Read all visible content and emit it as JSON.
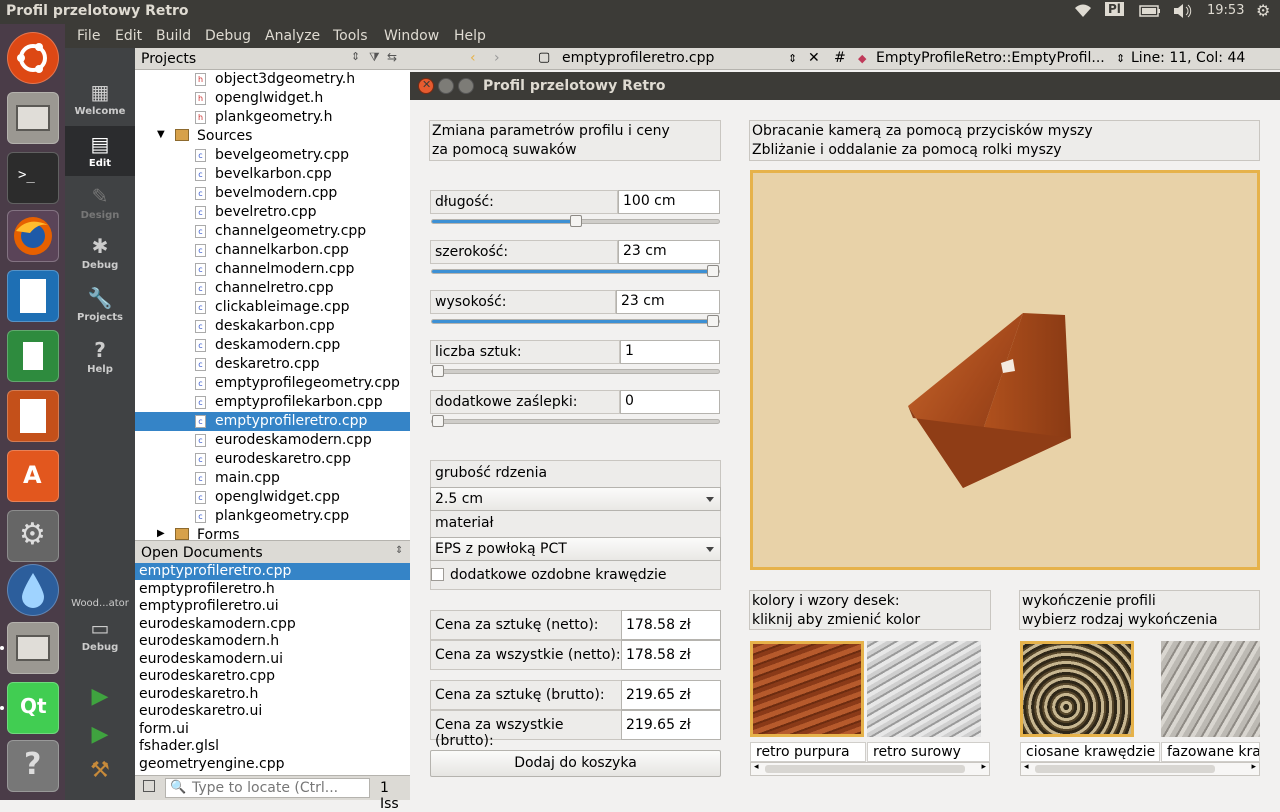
{
  "topbar": {
    "title": "Profil przelotowy Retro",
    "keyboard": "Pl",
    "time": "19:53"
  },
  "launcher": {
    "icons": [
      "ubuntu-icon",
      "files-icon",
      "terminal-icon",
      "firefox-icon",
      "writer-icon",
      "calc-icon",
      "impress-icon",
      "software-center-icon",
      "settings-icon",
      "drop-icon",
      "files-icon",
      "qt-creator-icon",
      "help-icon"
    ]
  },
  "menubar": {
    "items": [
      "File",
      "Edit",
      "Build",
      "Debug",
      "Analyze",
      "Tools",
      "Window",
      "Help"
    ]
  },
  "modes": {
    "welcome": "Welcome",
    "edit": "Edit",
    "design": "Design",
    "debug": "Debug",
    "projects": "Projects",
    "help": "Help",
    "kit_name": "Wood...ator",
    "kit_mode": "Debug"
  },
  "projects": {
    "header": "Projects",
    "rows": [
      {
        "name": "object3dgeometry.h",
        "type": "h"
      },
      {
        "name": "openglwidget.h",
        "type": "h"
      },
      {
        "name": "plankgeometry.h",
        "type": "h"
      },
      {
        "name": "Sources",
        "type": "folder"
      },
      {
        "name": "bevelgeometry.cpp",
        "type": "cpp"
      },
      {
        "name": "bevelkarbon.cpp",
        "type": "cpp"
      },
      {
        "name": "bevelmodern.cpp",
        "type": "cpp"
      },
      {
        "name": "bevelretro.cpp",
        "type": "cpp"
      },
      {
        "name": "channelgeometry.cpp",
        "type": "cpp"
      },
      {
        "name": "channelkarbon.cpp",
        "type": "cpp"
      },
      {
        "name": "channelmodern.cpp",
        "type": "cpp"
      },
      {
        "name": "channelretro.cpp",
        "type": "cpp"
      },
      {
        "name": "clickableimage.cpp",
        "type": "cpp"
      },
      {
        "name": "deskakarbon.cpp",
        "type": "cpp"
      },
      {
        "name": "deskamodern.cpp",
        "type": "cpp"
      },
      {
        "name": "deskaretro.cpp",
        "type": "cpp"
      },
      {
        "name": "emptyprofilegeometry.cpp",
        "type": "cpp"
      },
      {
        "name": "emptyprofilekarbon.cpp",
        "type": "cpp"
      },
      {
        "name": "emptyprofileretro.cpp",
        "type": "cpp",
        "selected": true
      },
      {
        "name": "eurodeskamodern.cpp",
        "type": "cpp"
      },
      {
        "name": "eurodeskaretro.cpp",
        "type": "cpp"
      },
      {
        "name": "main.cpp",
        "type": "cpp"
      },
      {
        "name": "openglwidget.cpp",
        "type": "cpp"
      },
      {
        "name": "plankgeometry.cpp",
        "type": "cpp"
      },
      {
        "name": "Forms",
        "type": "folder"
      }
    ]
  },
  "open_documents": {
    "header": "Open Documents",
    "items": [
      "emptyprofileretro.cpp",
      "emptyprofileretro.h",
      "emptyprofileretro.ui",
      "eurodeskamodern.cpp",
      "eurodeskamodern.h",
      "eurodeskamodern.ui",
      "eurodeskaretro.cpp",
      "eurodeskaretro.h",
      "eurodeskaretro.ui",
      "form.ui",
      "fshader.glsl",
      "geometryengine.cpp"
    ]
  },
  "locator": {
    "placeholder": "Type to locate (Ctrl...",
    "issues": "1  Iss"
  },
  "editor": {
    "file": "emptyprofileretro.cpp",
    "symbol": "EmptyProfileRetro::EmptyProfil...",
    "position": "Line: 11, Col: 44"
  },
  "app": {
    "title": "Profil przelotowy Retro",
    "intro_line1": "Zmiana parametrów profilu i ceny",
    "intro_line2": "za pomocą suwaków",
    "camera_line1": "Obracanie kamerą za pomocą przycisków myszy",
    "camera_line2": "Zbliżanie i oddalanie za pomocą rolki myszy",
    "params": [
      {
        "label": "długość:",
        "value": "100 cm",
        "level": 0.5
      },
      {
        "label": "szerokość:",
        "value": "23 cm",
        "level": 1.0
      },
      {
        "label": "wysokość:",
        "value": "23 cm",
        "level": 1.0
      },
      {
        "label": "liczba sztuk:",
        "value": "1",
        "level": 0.0
      },
      {
        "label": "dodatkowe zaślepki:",
        "value": "0",
        "level": 0.0
      }
    ],
    "core_label": "grubość rdzenia",
    "core_value": "2.5 cm",
    "material_label": "materiał",
    "material_value": "EPS z powłoką PCT",
    "extra_edges": "dodatkowe ozdobne krawędzie",
    "prices": [
      {
        "label": "Cena za sztukę (netto):",
        "value": "178.58 zł"
      },
      {
        "label": "Cena za wszystkie (netto):",
        "value": "178.58 zł"
      },
      {
        "label": "Cena za sztukę (brutto):",
        "value": "219.65 zł"
      },
      {
        "label": "Cena za wszystkie (brutto):",
        "value": "219.65 zł"
      }
    ],
    "add_to_cart": "Dodaj do koszyka",
    "colors_line1": "kolory i wzory desek:",
    "colors_line2": "kliknij aby zmienić kolor",
    "finish_line1": "wykończenie profili",
    "finish_line2": "wybierz rodzaj wykończenia",
    "color_options": [
      "retro purpura",
      "retro surowy"
    ],
    "finish_options": [
      "ciosane krawędzie",
      "fazowane kraw"
    ]
  },
  "colors": {
    "accent": "#3584c7",
    "highlight": "#e6b24a",
    "titlebar": "#3c3b37",
    "launcher": "#4a3c48"
  }
}
